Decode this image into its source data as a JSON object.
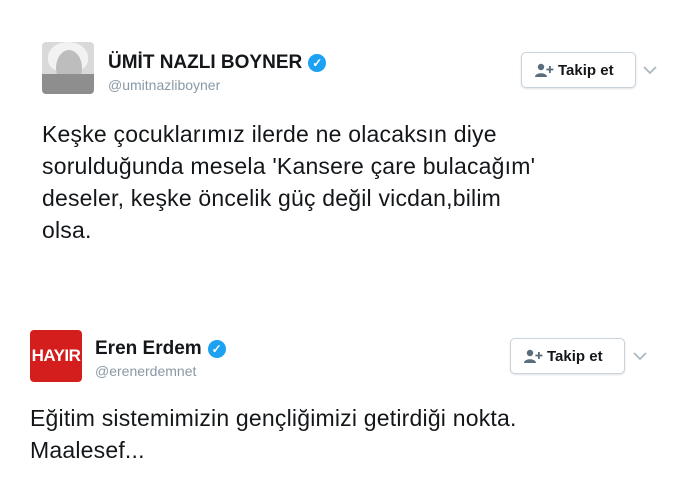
{
  "tweets": [
    {
      "name": "ÜMİT NAZLI BOYNER",
      "handle": "@umitnazliboyner",
      "follow_label": "Takip et",
      "text_lines": [
        "Keşke çocuklarımız ilerde ne olacaksın diye",
        "sorulduğunda mesela 'Kansere çare bulacağım'",
        "deseler, keşke öncelik güç değil vicdan,bilim",
        "olsa."
      ]
    },
    {
      "name": "Eren Erdem",
      "handle": "@erenerdemnet",
      "avatar_text": "HAYIR",
      "follow_label": "Takip et",
      "text_lines": [
        "Eğitim sistemimizin gençliğimizi getirdiği nokta.",
        "Maalesef..."
      ]
    }
  ],
  "colors": {
    "verified": "#1da1f2",
    "handle": "#8899a6",
    "avatar_red": "#d41d1d",
    "button_border": "#c8d3dc"
  },
  "icons": {
    "verified": "verified-badge-icon",
    "follow": "add-user-icon",
    "menu": "chevron-down-icon"
  }
}
